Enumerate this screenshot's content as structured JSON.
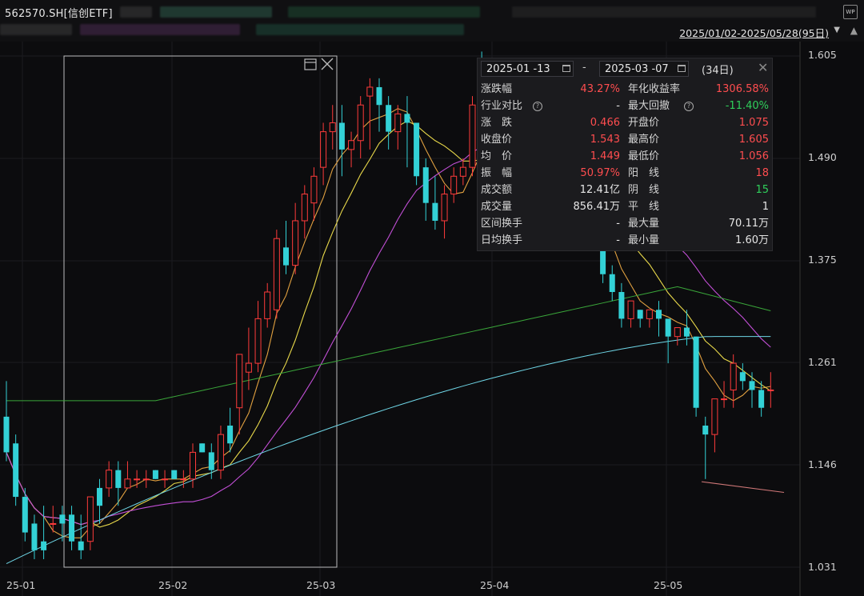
{
  "header": {
    "ticker": "562570.SH[信创ETF]",
    "range": "2025/01/02-2025/05/28(95日)",
    "wp_icon": "WP"
  },
  "y_axis": {
    "ticks": [
      "1.605",
      "1.490",
      "1.375",
      "1.261",
      "1.146",
      "1.031"
    ]
  },
  "x_axis": {
    "ticks": [
      "25-01",
      "25-02",
      "25-03",
      "25-04",
      "25-05"
    ]
  },
  "colors": {
    "up": "#ff3b3b",
    "down": "#33d1d6",
    "ma5": "#e0a040",
    "ma10": "#e8d84a",
    "ma20": "#c24fd6",
    "ma60": "#3aa63a",
    "ma120": "#6fd6e6"
  },
  "panel": {
    "start_date": "2025-01 -13",
    "sep": "-",
    "end_date": "2025-03 -07",
    "days": "(34日)",
    "rows": [
      {
        "l1": "涨跌幅",
        "v1": "43.27%",
        "c1": "red",
        "l2": "年化收益率",
        "v2": "1306.58%",
        "c2": "red"
      },
      {
        "l1": "行业对比",
        "q1": true,
        "v1": "-",
        "c1": "white",
        "l2": "最大回撤",
        "q2": true,
        "v2": "-11.40%",
        "c2": "green"
      },
      {
        "l1": "涨　跌",
        "v1": "0.466",
        "c1": "red",
        "l2": "开盘价",
        "v2": "1.075",
        "c2": "red"
      },
      {
        "l1": "收盘价",
        "v1": "1.543",
        "c1": "red",
        "l2": "最高价",
        "v2": "1.605",
        "c2": "red"
      },
      {
        "l1": "均　价",
        "v1": "1.449",
        "c1": "red",
        "l2": "最低价",
        "v2": "1.056",
        "c2": "red"
      },
      {
        "l1": "振　幅",
        "v1": "50.97%",
        "c1": "red",
        "l2": "阳　线",
        "v2": "18",
        "c2": "red"
      },
      {
        "l1": "成交额",
        "v1": "12.41亿",
        "c1": "white",
        "l2": "阴　线",
        "v2": "15",
        "c2": "green"
      },
      {
        "l1": "成交量",
        "v1": "856.41万",
        "c1": "white",
        "l2": "平　线",
        "v2": "1",
        "c2": "white"
      },
      {
        "l1": "区间换手",
        "v1": "-",
        "c1": "white",
        "l2": "最大量",
        "v2": "70.11万",
        "c2": "white"
      },
      {
        "l1": "日均换手",
        "v1": "-",
        "c1": "white",
        "l2": "最小量",
        "v2": "1.60万",
        "c2": "white"
      }
    ]
  },
  "chart_data": {
    "type": "candlestick",
    "ylim": [
      1.031,
      1.605
    ],
    "ohlc": [
      [
        1.2,
        1.24,
        1.16,
        1.15
      ],
      [
        1.17,
        1.18,
        1.11,
        1.1
      ],
      [
        1.11,
        1.12,
        1.07,
        1.06
      ],
      [
        1.08,
        1.09,
        1.05,
        1.04
      ],
      [
        1.06,
        1.1,
        1.05,
        1.04
      ],
      [
        1.08,
        1.1,
        1.08,
        1.07
      ],
      [
        1.09,
        1.1,
        1.08,
        1.06
      ],
      [
        1.09,
        1.1,
        1.06,
        1.05
      ],
      [
        1.06,
        1.09,
        1.05,
        1.04
      ],
      [
        1.06,
        1.11,
        1.11,
        1.05
      ],
      [
        1.12,
        1.13,
        1.1,
        1.08
      ],
      [
        1.12,
        1.15,
        1.14,
        1.11
      ],
      [
        1.14,
        1.15,
        1.12,
        1.1
      ],
      [
        1.12,
        1.15,
        1.13,
        1.12
      ],
      [
        1.13,
        1.14,
        1.13,
        1.12
      ],
      [
        1.13,
        1.14,
        1.13,
        1.12
      ],
      [
        1.14,
        1.14,
        1.13,
        1.13
      ],
      [
        1.13,
        1.14,
        1.13,
        1.12
      ],
      [
        1.14,
        1.14,
        1.13,
        1.13
      ],
      [
        1.13,
        1.14,
        1.13,
        1.12
      ],
      [
        1.13,
        1.17,
        1.16,
        1.12
      ],
      [
        1.17,
        1.17,
        1.16,
        1.16
      ],
      [
        1.16,
        1.17,
        1.14,
        1.13
      ],
      [
        1.14,
        1.19,
        1.18,
        1.13
      ],
      [
        1.19,
        1.21,
        1.17,
        1.16
      ],
      [
        1.21,
        1.26,
        1.27,
        1.18
      ],
      [
        1.25,
        1.3,
        1.26,
        1.23
      ],
      [
        1.26,
        1.33,
        1.31,
        1.25
      ],
      [
        1.31,
        1.35,
        1.34,
        1.3
      ],
      [
        1.32,
        1.41,
        1.4,
        1.31
      ],
      [
        1.39,
        1.42,
        1.37,
        1.36
      ],
      [
        1.37,
        1.44,
        1.42,
        1.36
      ],
      [
        1.42,
        1.46,
        1.45,
        1.4
      ],
      [
        1.44,
        1.48,
        1.47,
        1.42
      ],
      [
        1.48,
        1.53,
        1.52,
        1.46
      ],
      [
        1.52,
        1.55,
        1.53,
        1.5
      ],
      [
        1.53,
        1.55,
        1.5,
        1.47
      ],
      [
        1.5,
        1.52,
        1.51,
        1.48
      ],
      [
        1.51,
        1.56,
        1.55,
        1.49
      ],
      [
        1.56,
        1.58,
        1.57,
        1.5
      ],
      [
        1.57,
        1.58,
        1.55,
        1.52
      ],
      [
        1.55,
        1.56,
        1.52,
        1.5
      ],
      [
        1.52,
        1.55,
        1.54,
        1.5
      ],
      [
        1.54,
        1.56,
        1.53,
        1.48
      ],
      [
        1.53,
        1.53,
        1.47,
        1.46
      ],
      [
        1.48,
        1.49,
        1.44,
        1.42
      ],
      [
        1.44,
        1.47,
        1.42,
        1.41
      ],
      [
        1.42,
        1.46,
        1.45,
        1.4
      ],
      [
        1.45,
        1.48,
        1.47,
        1.44
      ],
      [
        1.47,
        1.49,
        1.48,
        1.46
      ],
      [
        1.48,
        1.56,
        1.55,
        1.47
      ],
      [
        1.55,
        1.61,
        1.54,
        1.5
      ],
      [
        1.54,
        1.54,
        1.52,
        1.51
      ],
      [
        1.52,
        1.53,
        1.5,
        1.49
      ],
      [
        1.5,
        1.51,
        1.49,
        1.48
      ],
      [
        1.5,
        1.5,
        1.48,
        1.47
      ],
      [
        1.48,
        1.49,
        1.45,
        1.44
      ],
      [
        1.45,
        1.46,
        1.43,
        1.42
      ],
      [
        1.44,
        1.45,
        1.44,
        1.43
      ],
      [
        1.44,
        1.45,
        1.44,
        1.42
      ],
      [
        1.44,
        1.46,
        1.47,
        1.43
      ],
      [
        1.47,
        1.47,
        1.45,
        1.44
      ],
      [
        1.45,
        1.45,
        1.42,
        1.41
      ],
      [
        1.42,
        1.43,
        1.4,
        1.39
      ],
      [
        1.4,
        1.4,
        1.36,
        1.35
      ],
      [
        1.36,
        1.37,
        1.34,
        1.33
      ],
      [
        1.34,
        1.35,
        1.31,
        1.3
      ],
      [
        1.31,
        1.33,
        1.33,
        1.3
      ],
      [
        1.32,
        1.32,
        1.31,
        1.3
      ],
      [
        1.31,
        1.32,
        1.32,
        1.3
      ],
      [
        1.32,
        1.33,
        1.31,
        1.29
      ],
      [
        1.31,
        1.31,
        1.29,
        1.26
      ],
      [
        1.29,
        1.3,
        1.3,
        1.28
      ],
      [
        1.3,
        1.32,
        1.29,
        1.28
      ],
      [
        1.29,
        1.29,
        1.21,
        1.2
      ],
      [
        1.19,
        1.2,
        1.18,
        1.13
      ],
      [
        1.18,
        1.22,
        1.22,
        1.16
      ],
      [
        1.22,
        1.24,
        1.22,
        1.21
      ],
      [
        1.23,
        1.27,
        1.26,
        1.21
      ],
      [
        1.25,
        1.26,
        1.24,
        1.23
      ],
      [
        1.24,
        1.25,
        1.23,
        1.21
      ],
      [
        1.23,
        1.24,
        1.21,
        1.2
      ],
      [
        1.23,
        1.25,
        1.23,
        1.21
      ]
    ]
  }
}
